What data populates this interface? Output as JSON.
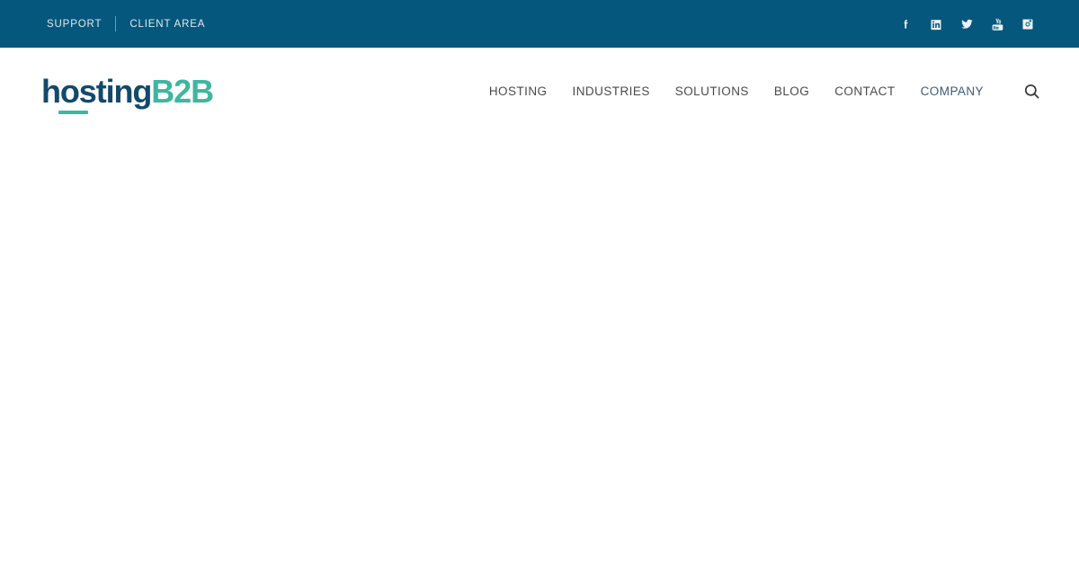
{
  "topbar": {
    "background_color": "#05577d",
    "links": [
      {
        "label": "SUPPORT",
        "name": "support"
      },
      {
        "label": "CLIENT AREA",
        "name": "client-area"
      }
    ],
    "social": [
      {
        "name": "facebook",
        "label": "Facebook",
        "icon": "facebook-icon"
      },
      {
        "name": "linkedin",
        "label": "LinkedIn",
        "icon": "linkedin-icon"
      },
      {
        "name": "twitter",
        "label": "Twitter",
        "icon": "twitter-icon"
      },
      {
        "name": "youtube",
        "label": "YouTube",
        "icon": "youtube-icon"
      },
      {
        "name": "instagram",
        "label": "Instagram",
        "icon": "instagram-icon"
      }
    ]
  },
  "header": {
    "logo": {
      "part_1": "hosting",
      "part_2": "B2B",
      "full_text": "hostingB2B",
      "color_primary": "#13496b",
      "color_accent": "#3fb69f"
    },
    "nav": [
      {
        "label": "HOSTING",
        "name": "hosting",
        "active": false
      },
      {
        "label": "INDUSTRIES",
        "name": "industries",
        "active": false
      },
      {
        "label": "SOLUTIONS",
        "name": "solutions",
        "active": false
      },
      {
        "label": "BLOG",
        "name": "blog",
        "active": false
      },
      {
        "label": "CONTACT",
        "name": "contact",
        "active": false
      },
      {
        "label": "COMPANY",
        "name": "company",
        "active": true
      }
    ],
    "search": {
      "icon": "search-icon",
      "label": "Search"
    },
    "active_nav_color": "#3c5a78",
    "nav_color": "#4a4a4a"
  },
  "main": {
    "content": "",
    "background_color": "#ffffff"
  }
}
